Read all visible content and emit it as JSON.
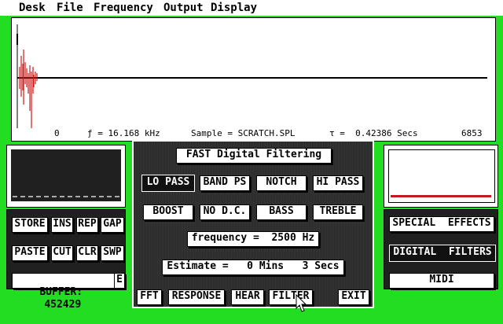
{
  "menubar": {
    "items": [
      "Desk",
      "File",
      "Frequency",
      "Output",
      "Display"
    ]
  },
  "waveform": {
    "status": {
      "start": "0",
      "freq": "ƒ = 16.168 kHz",
      "sample": "Sample = SCRATCH.SPL",
      "time": "τ =  0.42386 Secs",
      "end": "6853"
    }
  },
  "edit": {
    "store": "STORE",
    "ins": "INS",
    "rep": "REP",
    "gap": "GAP",
    "paste": "PASTE",
    "cut": "CUT",
    "clr": "CLR",
    "swp": "SWP",
    "buffer_label": "BUFFER:",
    "buffer_value": "452429",
    "e": "E"
  },
  "filter": {
    "title": "FAST Digital Filtering",
    "lo_pass": "LO PASS",
    "band_ps": "BAND PS",
    "notch": "NOTCH",
    "hi_pass": "HI PASS",
    "boost": "BOOST",
    "no_dc": "NO D.C.",
    "bass": "BASS",
    "treble": "TREBLE",
    "frequency": "frequency =  2500 Hz",
    "estimate": "Estimate =   0 Mins   3 Secs",
    "fft": "FFT",
    "response": "RESPONSE",
    "hear": "HEAR",
    "filter": "FILTER",
    "exit": "EXIT"
  },
  "fx": {
    "special": "SPECIAL  EFFECTS",
    "digital": "DIGITAL  FILTERS",
    "midi": "MIDI"
  },
  "colors": {
    "background": "#22dd22",
    "wave": "#d01818",
    "panel": "#202020"
  }
}
